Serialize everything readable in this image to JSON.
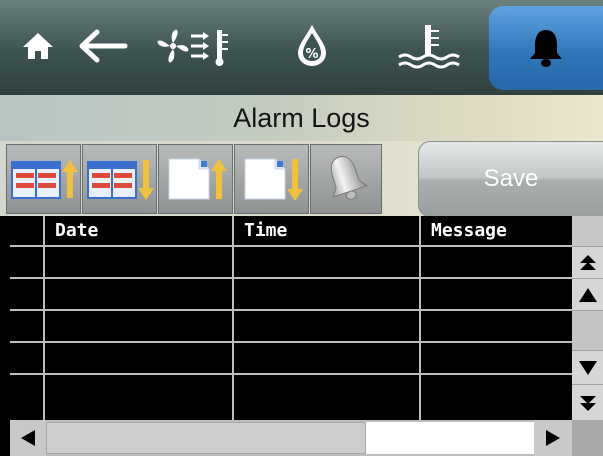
{
  "nav": {
    "icons": [
      "home-icon",
      "back-arrow-icon",
      "fan-temperature-icon",
      "humidity-icon",
      "water-temperature-icon",
      "bell-icon"
    ],
    "humidity_symbol": "%"
  },
  "header": {
    "title": "Alarm Logs"
  },
  "toolbar": {
    "icons": [
      "table-scroll-up-icon",
      "table-scroll-down-icon",
      "page-up-icon",
      "page-down-icon",
      "bell-silence-icon"
    ],
    "save_label": "Save"
  },
  "table": {
    "columns": [
      "Date",
      "Time",
      "Message"
    ],
    "rows": []
  },
  "colors": {
    "nav_bg": "#3d5352",
    "active_tab": "#2d74b8",
    "table_bg": "#000000",
    "grid_line": "#bdbdbd",
    "header_text": "#ffffff"
  }
}
